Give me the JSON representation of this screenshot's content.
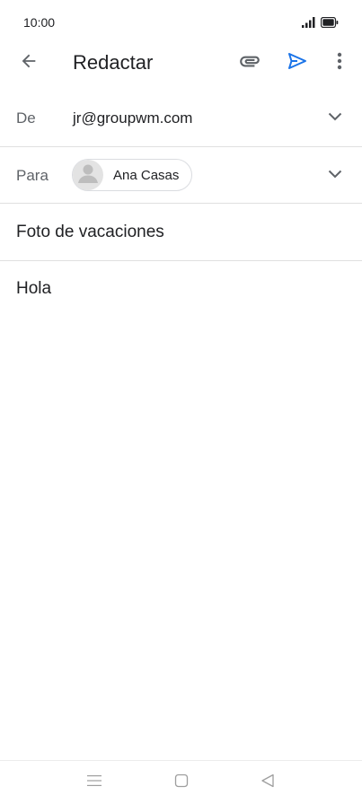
{
  "status_bar": {
    "time": "10:00",
    "icons": [
      "signal-icon",
      "battery-icon"
    ]
  },
  "app_bar": {
    "title": "Redactar",
    "icons": [
      "back-arrow-icon",
      "attach-icon",
      "send-icon",
      "more-vert-icon"
    ]
  },
  "compose": {
    "from_label": "De",
    "from_value": "jr@groupwm.com",
    "to_label": "Para",
    "to_recipient": "Ana Casas",
    "subject": "Foto de vacaciones",
    "body": "Hola"
  },
  "colors": {
    "send_accent": "#1a73e8",
    "divider": "#e0e0e0",
    "label": "#5f6368"
  },
  "nav_bar": {
    "icons": [
      "menu-icon",
      "home-icon",
      "back-icon"
    ]
  }
}
